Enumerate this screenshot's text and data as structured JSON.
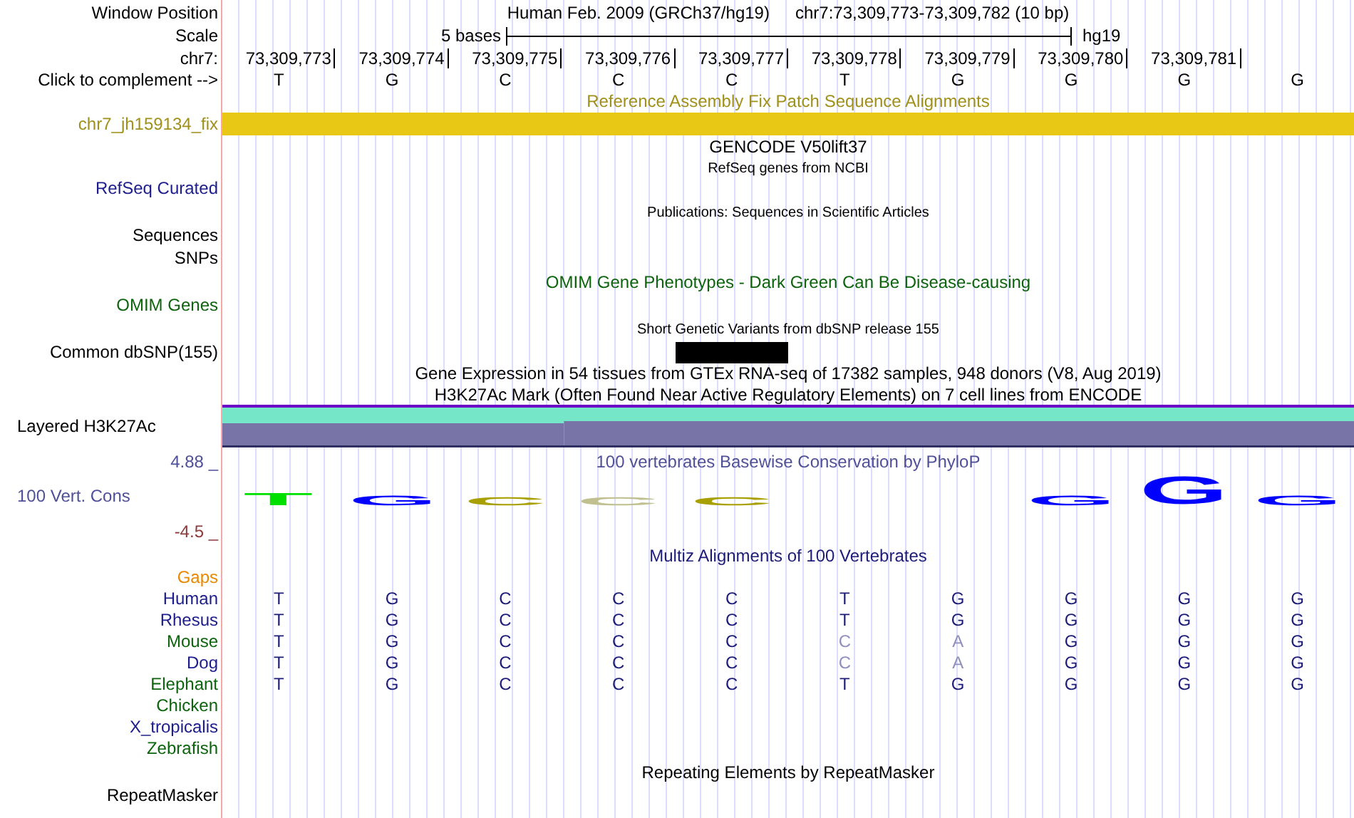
{
  "header": {
    "window_label": "Window Position",
    "assembly": "Human Feb. 2009 (GRCh37/hg19)",
    "position": "chr7:73,309,773-73,309,782 (10 bp)",
    "scale_label": "Scale",
    "scale_text": "5 bases",
    "scale_db": "hg19",
    "chrom_label": "chr7:",
    "positions": [
      "73,309,773",
      "73,309,774",
      "73,309,775",
      "73,309,776",
      "73,309,777",
      "73,309,778",
      "73,309,779",
      "73,309,780",
      "73,309,781"
    ],
    "complement_label": "Click to complement -->",
    "bases": [
      "T",
      "G",
      "C",
      "C",
      "C",
      "T",
      "G",
      "G",
      "G",
      "G"
    ]
  },
  "tracks": [
    {
      "kind": "bar",
      "title": "Reference Assembly Fix Patch Sequence Alignments",
      "labels": [
        "chr7_jh159134_fix"
      ],
      "color": "#a0901c"
    },
    {
      "kind": "title",
      "title": "GENCODE V50lift37",
      "color": "#000000"
    },
    {
      "kind": "gene",
      "title": "RefSeq genes from NCBI",
      "labels": [
        "RefSeq Curated"
      ],
      "color": "#1c1c8c"
    },
    {
      "kind": "labels",
      "title": "Publications: Sequences in Scientific Articles",
      "labels": [
        "Sequences",
        "SNPs"
      ],
      "color": "#000000"
    },
    {
      "kind": "gene",
      "title": "OMIM Gene Phenotypes - Dark Green Can Be Disease-causing",
      "labels": [
        "OMIM Genes"
      ],
      "color": "#0c640c"
    },
    {
      "kind": "snp",
      "title": "Short Genetic Variants from dbSNP release 155",
      "labels": [
        "Common dbSNP(155)"
      ],
      "color": "#000000"
    },
    {
      "kind": "title",
      "title": "Gene Expression in 54 tissues from GTEx RNA-seq of 17382 samples, 948 donors (V8, Aug 2019)",
      "color": "#000000"
    },
    {
      "kind": "layered",
      "title": "H3K27Ac Mark (Often Found Near Active Regulatory Elements) on 7 cell lines from ENCODE",
      "labels": [
        "Layered H3K27Ac"
      ],
      "color": "#000000"
    },
    {
      "kind": "logo",
      "title": "100 vertebrates Basewise Conservation by PhyloP",
      "labels": [
        "100 Vert. Cons"
      ],
      "color": "#505098",
      "ymax": "4.88 _",
      "ymin": "-4.5 _",
      "logo": [
        {
          "kind": "medium",
          "base": "T",
          "color": "#00e000"
        },
        {
          "kind": "short",
          "base": "G",
          "color": "#0000ff"
        },
        {
          "kind": "flat",
          "base": "C",
          "color": "#a8a000"
        },
        {
          "kind": "flat",
          "base": "C",
          "color": "#c0c090"
        },
        {
          "kind": "flat",
          "base": "C",
          "color": "#a8a000"
        },
        {
          "kind": "blank"
        },
        {
          "kind": "blank"
        },
        {
          "kind": "short",
          "base": "G",
          "color": "#0000ff"
        },
        {
          "kind": "tall",
          "base": "G",
          "color": "#0000ff"
        },
        {
          "kind": "short",
          "base": "G",
          "color": "#0000ff"
        }
      ]
    },
    {
      "kind": "multiz",
      "title": "Multiz Alignments of 100 Vertebrates",
      "gaps_label": "Gaps",
      "color": "#1c1c78",
      "species": [
        {
          "name": "Human",
          "color": "#1c1c8c",
          "bases": [
            "T",
            "G",
            "C",
            "C",
            "C",
            "T",
            "G",
            "G",
            "G",
            "G"
          ],
          "faded": [
            false,
            false,
            false,
            false,
            false,
            false,
            false,
            false,
            false,
            false
          ]
        },
        {
          "name": "Rhesus",
          "color": "#1c1c8c",
          "bases": [
            "T",
            "G",
            "C",
            "C",
            "C",
            "T",
            "G",
            "G",
            "G",
            "G"
          ],
          "faded": [
            false,
            false,
            false,
            false,
            false,
            false,
            false,
            false,
            false,
            false
          ]
        },
        {
          "name": "Mouse",
          "color": "#0c640c",
          "bases": [
            "T",
            "G",
            "C",
            "C",
            "C",
            "C",
            "A",
            "G",
            "G",
            "G"
          ],
          "faded": [
            false,
            false,
            false,
            false,
            false,
            true,
            true,
            false,
            false,
            false
          ]
        },
        {
          "name": "Dog",
          "color": "#1c1c8c",
          "bases": [
            "T",
            "G",
            "C",
            "C",
            "C",
            "C",
            "A",
            "G",
            "G",
            "G"
          ],
          "faded": [
            false,
            false,
            false,
            false,
            false,
            true,
            true,
            false,
            false,
            false
          ]
        },
        {
          "name": "Elephant",
          "color": "#0c640c",
          "bases": [
            "T",
            "G",
            "C",
            "C",
            "C",
            "T",
            "G",
            "G",
            "G",
            "G"
          ],
          "faded": [
            false,
            false,
            false,
            false,
            false,
            false,
            false,
            false,
            false,
            false
          ]
        },
        {
          "name": "Chicken",
          "color": "#0c640c"
        },
        {
          "name": "X_tropicalis",
          "color": "#1c1c8c"
        },
        {
          "name": "Zebrafish",
          "color": "#0c640c"
        }
      ]
    },
    {
      "kind": "gene",
      "title": "Repeating Elements by RepeatMasker",
      "labels": [
        "RepeatMasker"
      ],
      "color": "#000000"
    }
  ]
}
